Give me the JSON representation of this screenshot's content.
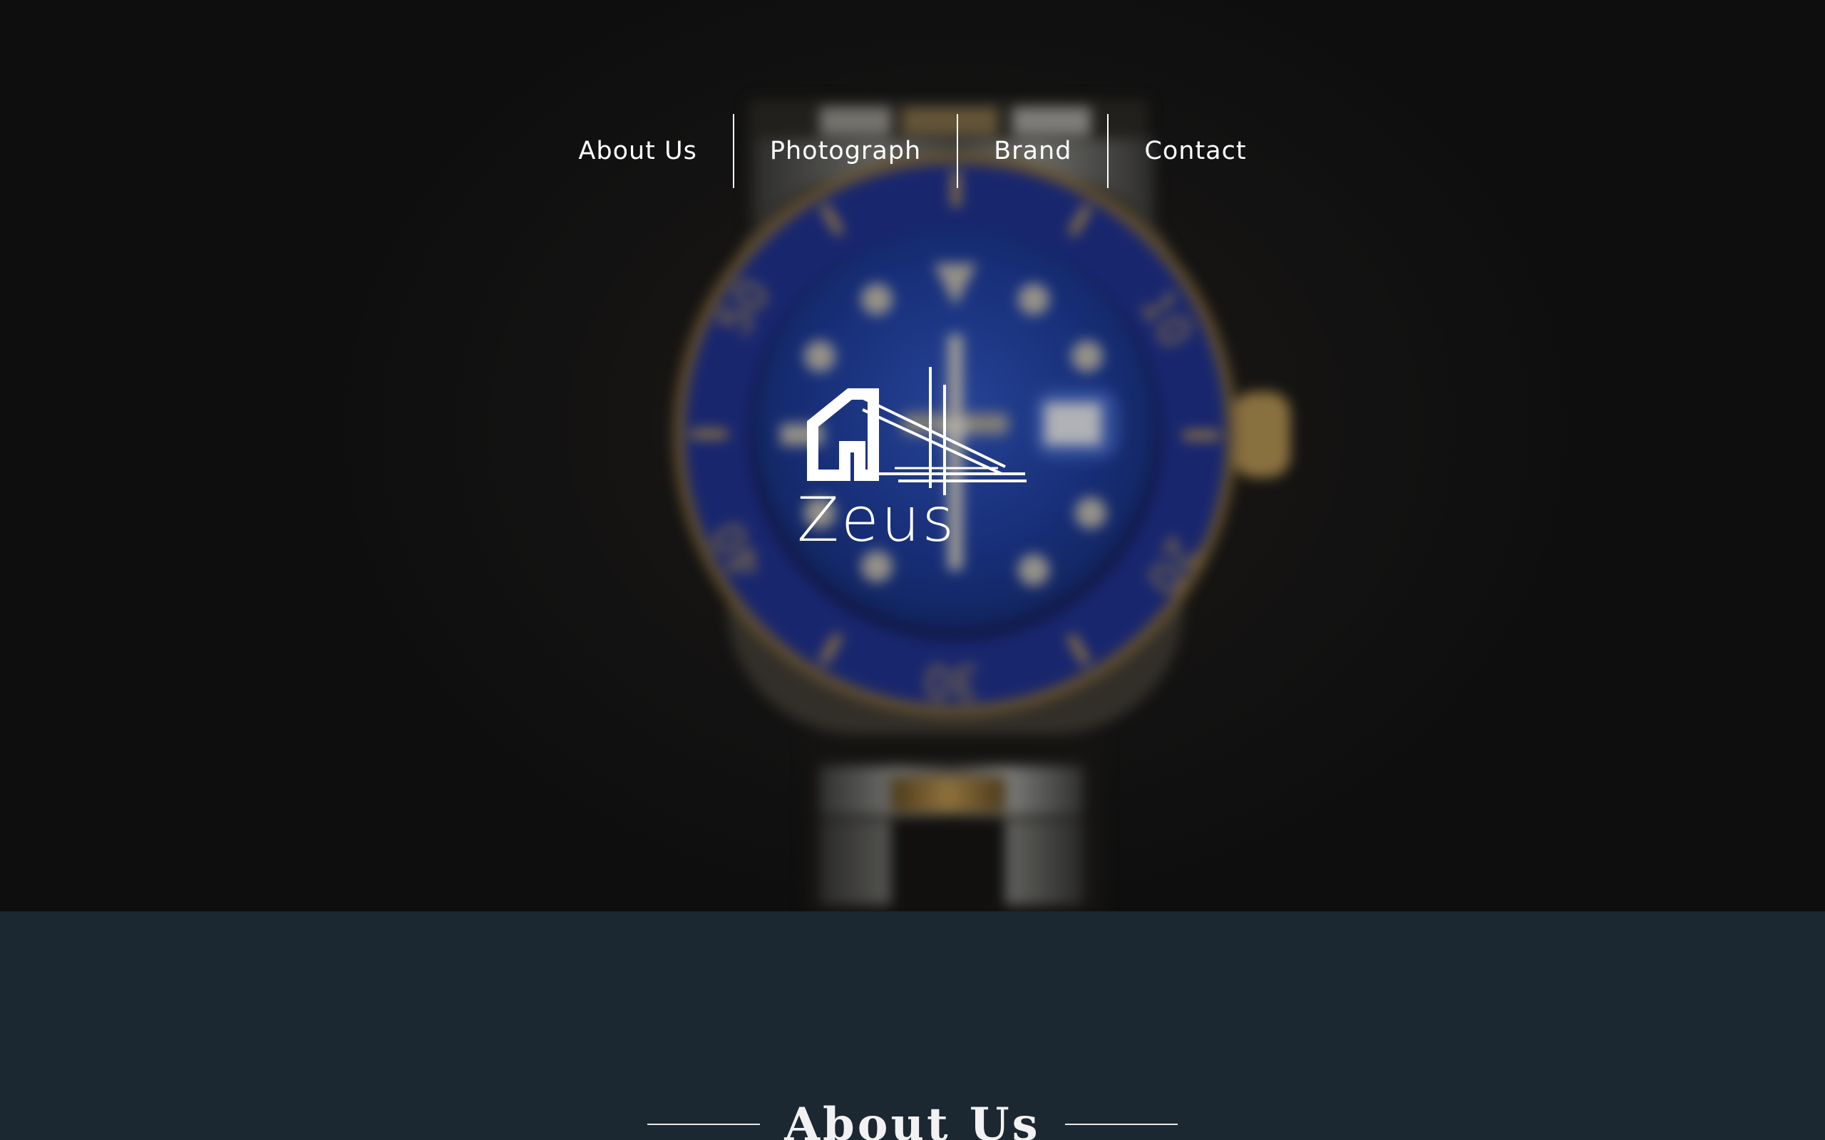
{
  "nav": {
    "items": [
      {
        "label": "About Us"
      },
      {
        "label": "Photograph"
      },
      {
        "label": "Brand"
      },
      {
        "label": "Contact"
      }
    ]
  },
  "logo": {
    "name": "Zeus",
    "icon": "house-icon"
  },
  "hero": {
    "background": "blurred-wristwatch-photo",
    "bezel_numbers": [
      "50",
      "10",
      "20",
      "30",
      "40"
    ]
  },
  "about": {
    "heading": "About Us"
  },
  "colors": {
    "section_bg": "#1b2731",
    "hero_bg": "#151515",
    "text": "#ffffff"
  }
}
